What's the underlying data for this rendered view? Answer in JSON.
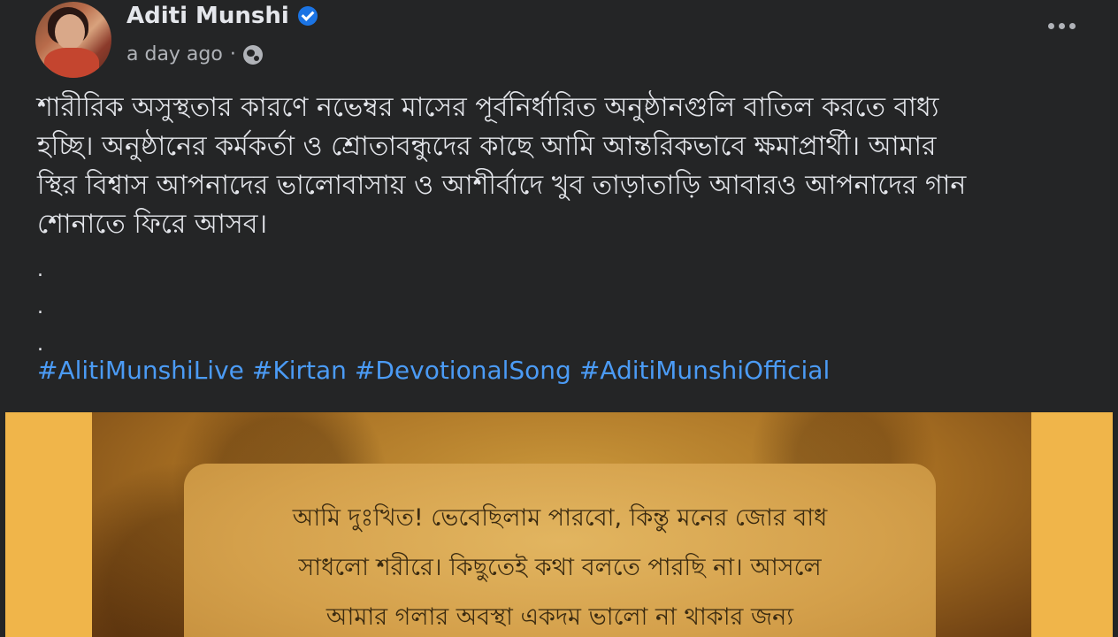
{
  "post": {
    "author": "Aditi Munshi",
    "timestamp": "a day ago",
    "separator": "·",
    "body_lines": [
      "শারীরিক অসুস্থতার কারণে নভেম্বর মাসের পূর্বনির্ধারিত অনুষ্ঠানগুলি বাতিল করতে বাধ্য",
      "হচ্ছি। অনুষ্ঠানের কর্মকর্তা ও শ্রোতাবন্ধুদের কাছে আমি আন্তরিকভাবে ক্ষমাপ্রার্থী। আমার",
      "স্থির বিশ্বাস আপনাদের ভালোবাসায় ও আশীর্বাদে খুব তাড়াতাড়ি আবারও আপনাদের গান",
      "শোনাতে ফিরে আসব।"
    ],
    "dots": [
      ".",
      ".",
      "."
    ],
    "hashtags": [
      "#AlitiMunshiLive",
      "#Kirtan",
      "#DevotionalSong",
      "#AditiMunshiOfficial"
    ]
  },
  "image_note": {
    "lines": [
      "আমি দুঃখিত! ভেবেছিলাম পারবো, কিন্তু মনের জোর বাধ",
      "সাধলো শরীরে। কিছুতেই কথা বলতে পারছি না। আসলে",
      "আমার গলার অবস্থা একদম ভালো না থাকার জন্য"
    ]
  },
  "icons": {
    "verified": "verified-badge-icon",
    "privacy": "globe-icon",
    "menu": "more-options-icon"
  },
  "colors": {
    "background": "#242526",
    "text": "#e4e6eb",
    "secondary_text": "#b0b3b8",
    "hashtag": "#4b9bf5",
    "verified": "#1b74e4",
    "image_border": "#f0b54a"
  }
}
